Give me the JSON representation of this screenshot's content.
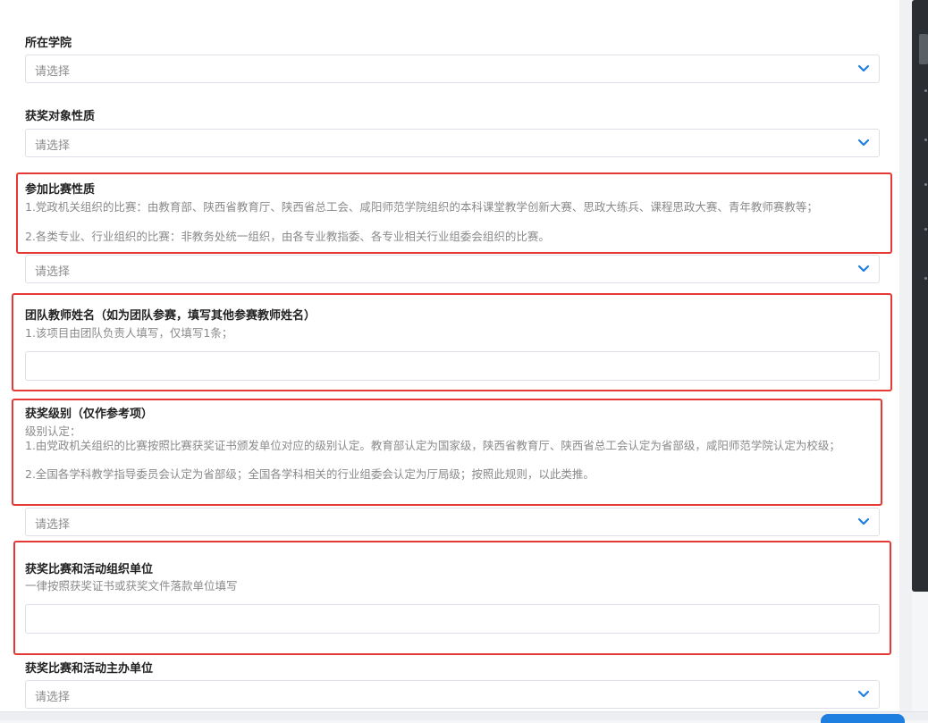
{
  "form": {
    "college": {
      "label": "所在学院",
      "placeholder": "请选择"
    },
    "award_target_nature": {
      "label": "获奖对象性质",
      "placeholder": "请选择"
    },
    "competition_nature": {
      "label": "参加比赛性质",
      "hint_line1": "1.党政机关组织的比赛：由教育部、陕西省教育厅、陕西省总工会、咸阳师范学院组织的本科课堂教学创新大赛、思政大练兵、课程思政大赛、青年教师赛教等；",
      "hint_line2": "2.各类专业、行业组织的比赛：非教务处统一组织，由各专业教指委、各专业相关行业组委会组织的比赛。",
      "placeholder": "请选择"
    },
    "team_teachers": {
      "label": "团队教师姓名（如为团队参赛，填写其他参赛教师姓名）",
      "hint": "1.该项目由团队负责人填写，仅填写1条；",
      "value": ""
    },
    "award_level": {
      "label": "获奖级别（仅作参考项）",
      "hint_line1": "级别认定：",
      "hint_line2": "1.由党政机关组织的比赛按照比赛获奖证书颁发单位对应的级别认定。教育部认定为国家级，陕西省教育厅、陕西省总工会认定为省部级，咸阳师范学院认定为校级；",
      "hint_line3": "2.全国各学科教学指导委员会认定为省部级；全国各学科相关的行业组委会认定为厅局级；按照此规则，以此类推。",
      "placeholder": "请选择"
    },
    "organizer": {
      "label": "获奖比赛和活动组织单位",
      "hint": "一律按照获奖证书或获奖文件落款单位填写",
      "value": ""
    },
    "host": {
      "label": "获奖比赛和活动主办单位",
      "placeholder": "请选择"
    }
  },
  "icons": {
    "select_arrow": "chevron-down-icon"
  },
  "colors": {
    "highlight_border": "#e53935",
    "chevron": "#1e7fe0",
    "primary_button": "#1e7fe0"
  }
}
